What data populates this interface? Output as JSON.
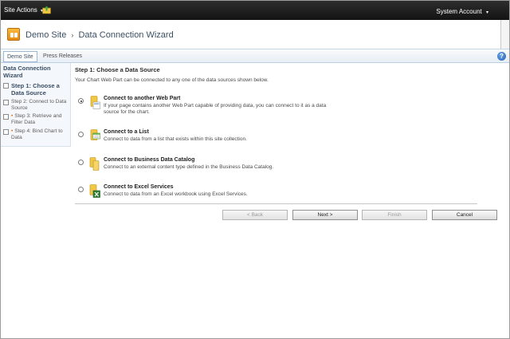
{
  "topbar": {
    "site_actions": "Site Actions",
    "account": "System Account"
  },
  "title": {
    "site": "Demo Site",
    "separator": "›",
    "page": "Data Connection Wizard"
  },
  "nav": {
    "tabs": [
      "Demo Site",
      "Press Releases"
    ],
    "help": "?"
  },
  "quicklaunch": {
    "heading": "Data Connection Wizard",
    "steps": [
      {
        "label": "Step 1: Choose a Data Source"
      },
      {
        "label": "Step 2: Connect to Data Source"
      },
      {
        "label": "Step 3: Retrieve and Filter Data"
      },
      {
        "label": "Step 4: Bind Chart to Data"
      }
    ]
  },
  "main": {
    "step_heading": "Step 1: Choose a Data Source",
    "description": "Your Chart Web Part can be connected to any one of the data sources shown below.",
    "options": [
      {
        "title": "Connect to another Web Part",
        "desc": "If your page contains another Web Part capable of providing data, you can connect to it as a data source for the chart.",
        "selected": true
      },
      {
        "title": "Connect to a List",
        "desc": "Connect to data from a list that exists within this site collection.",
        "selected": false
      },
      {
        "title": "Connect to Business Data Catalog",
        "desc": "Connect to an external content type defined in the Business Data Catalog.",
        "selected": false
      },
      {
        "title": "Connect to Excel Services",
        "desc": "Connect to data from an Excel workbook using Excel Services.",
        "selected": false
      }
    ],
    "buttons": {
      "back": "< Back",
      "next": "Next >",
      "finish": "Finish",
      "cancel": "Cancel"
    }
  },
  "icons": {
    "dropdown": "chevron-down-icon",
    "navigate_up": "folder-up-icon",
    "help": "help-icon"
  }
}
